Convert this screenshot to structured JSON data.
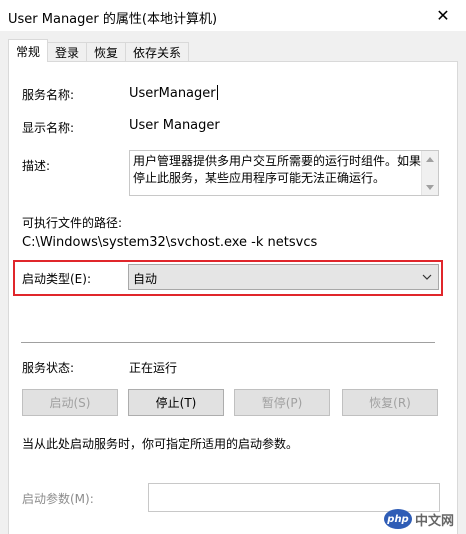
{
  "window": {
    "title": "User Manager 的属性(本地计算机)",
    "close_glyph": "✕"
  },
  "tabs": [
    {
      "label": "常规",
      "active": true
    },
    {
      "label": "登录",
      "active": false
    },
    {
      "label": "恢复",
      "active": false
    },
    {
      "label": "依存关系",
      "active": false
    }
  ],
  "general": {
    "service_name_label": "服务名称:",
    "service_name_value": "UserManager",
    "display_name_label": "显示名称:",
    "display_name_value": "User Manager",
    "description_label": "描述:",
    "description_value": "用户管理器提供多用户交互所需要的运行时组件。如果停止此服务，某些应用程序可能无法正确运行。",
    "exe_path_label": "可执行文件的路径:",
    "exe_path_value": "C:\\Windows\\system32\\svchost.exe -k netsvcs",
    "startup_type_label": "启动类型(E):",
    "startup_type_value": "自动",
    "service_status_label": "服务状态:",
    "service_status_value": "正在运行",
    "buttons": {
      "start": "启动(S)",
      "stop": "停止(T)",
      "pause": "暂停(P)",
      "resume": "恢复(R)"
    },
    "hint_text": "当从此处启动服务时，你可指定所适用的启动参数。",
    "start_params_label": "启动参数(M):",
    "start_params_value": ""
  },
  "watermark": {
    "logo_text": "php",
    "site_text": "中文网"
  },
  "colors": {
    "highlight_border": "#e0262b",
    "panel_bg": "#ffffff",
    "window_bg": "#f0f0f0"
  }
}
